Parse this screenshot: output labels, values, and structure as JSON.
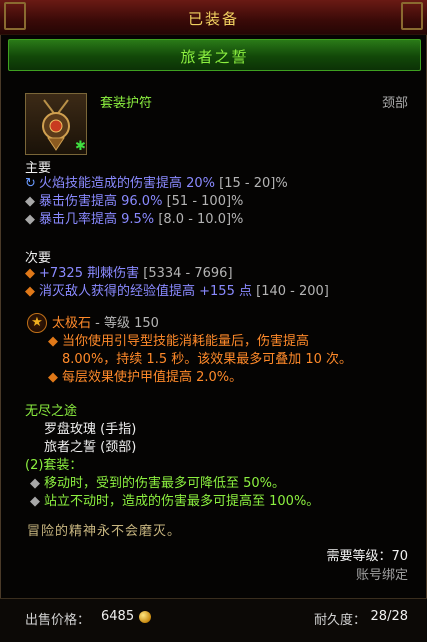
{
  "header": {
    "equipped_label": "已装备"
  },
  "item": {
    "name": "旅者之誓",
    "type": "套装护符",
    "slot": "颈部"
  },
  "primary": {
    "heading": "主要",
    "stats": [
      {
        "value": "火焰技能造成的伤害提高 20%",
        "range": "[15 - 20]%"
      },
      {
        "value": "暴击伤害提高 96.0%",
        "range": "[51 - 100]%"
      },
      {
        "value": "暴击几率提高 9.5%",
        "range": "[8.0 - 10.0]%"
      }
    ]
  },
  "secondary": {
    "heading": "次要",
    "stats": [
      {
        "value": "+7325 荆棘伤害",
        "range": "[5334 - 7696]"
      },
      {
        "value": "消灭敌人获得的经验值提高 +155 点",
        "range": "[140 - 200]"
      }
    ]
  },
  "legendary_gem": {
    "name": "太极石",
    "rank_text": "- 等级 150",
    "effect_line1": "当你使用引导型技能消耗能量后，伤害提高",
    "effect_line2": "8.00%，持续 1.5 秒。该效果最多可叠加 10 次。",
    "effect_extra": "每层效果使护甲值提高 2.0%。"
  },
  "set": {
    "name": "无尽之途",
    "pieces": [
      "罗盘玫瑰 (手指)",
      "旅者之誓 (颈部)"
    ],
    "bonus_label": "(2)套装：",
    "bonuses": [
      "移动时，受到的伤害最多可降低至 50%。",
      "站立不动时，造成的伤害最多可提高至 100%。"
    ]
  },
  "flavor_text": "冒险的精神永不会磨灭。",
  "requirements": {
    "level_text": "需要等级：70",
    "bound_text": "账号绑定"
  },
  "footer": {
    "price_label": "出售价格：",
    "price_value": "6485",
    "durability_label": "耐久度：",
    "durability_value": "28/28"
  },
  "colors": {
    "primary_stat": "#8a8aff",
    "set_green": "#8cf040",
    "gem_orange": "#ff8a2a",
    "title_gold": "#f0d060"
  },
  "icons": {
    "item_icon": "amulet-icon",
    "coin": "gold-coin-icon",
    "gem": "legendary-gem-icon"
  }
}
